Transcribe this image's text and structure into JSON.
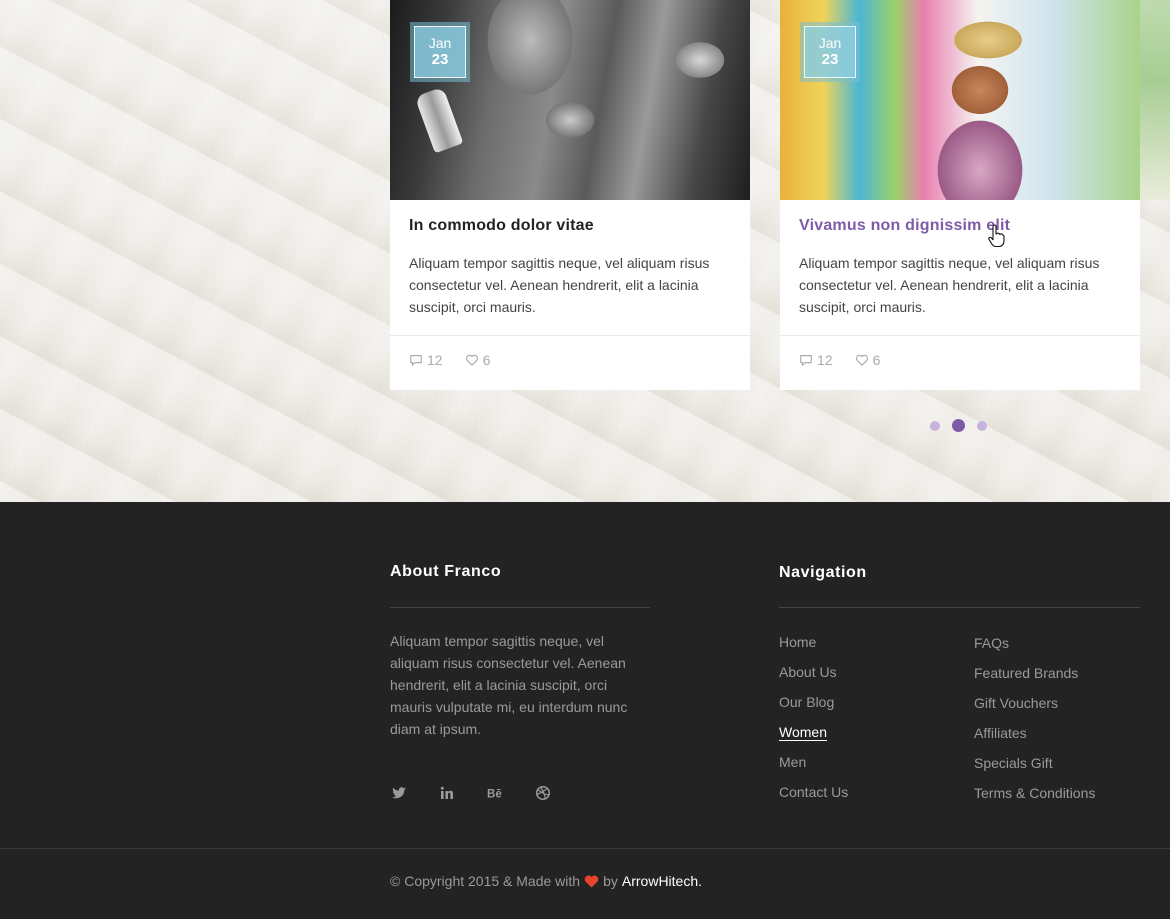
{
  "posts": [
    {
      "date_month": "Jan",
      "date_day": "23",
      "title": "In commodo dolor vitae",
      "excerpt": "Aliquam tempor sagittis neque, vel aliquam risus consectetur vel. Aenean hendrerit, elit a lacinia suscipit, orci mauris.",
      "comments": "12",
      "likes": "6"
    },
    {
      "date_month": "Jan",
      "date_day": "23",
      "title": "Vivamus non dignissim elit",
      "excerpt": "Aliquam tempor sagittis neque, vel aliquam risus consectetur vel. Aenean hendrerit, elit a lacinia suscipit, orci mauris.",
      "comments": "12",
      "likes": "6"
    }
  ],
  "carousel": {
    "active_page": 2,
    "total_pages": 3
  },
  "footer": {
    "about": {
      "title": "About Franco",
      "text": "Aliquam tempor sagittis neque, vel aliquam risus consectetur vel. Aenean hendrerit, elit a lacinia suscipit, orci mauris vulputate mi, eu interdum nunc diam at ipsum.",
      "socials": [
        "twitter-icon",
        "linkedin-icon",
        "behance-icon",
        "dribbble-icon"
      ]
    },
    "navigation": {
      "title": "Navigation",
      "left": [
        "Home",
        "About Us",
        "Our Blog",
        "Women",
        "Men",
        "Contact Us"
      ],
      "right": [
        "FAQs",
        "Featured Brands",
        "Gift Vouchers",
        "Affiliates",
        "Specials Gift",
        "Terms & Conditions"
      ],
      "active": "Women"
    },
    "copyright": {
      "prefix": "© Copyright 2015 & Made with",
      "by": "by",
      "brand": "ArrowHitech."
    }
  },
  "colors": {
    "accent": "#7e5ba8",
    "badge": "#8ccde1",
    "footer_bg": "#232323",
    "heart": "#e8452c"
  }
}
